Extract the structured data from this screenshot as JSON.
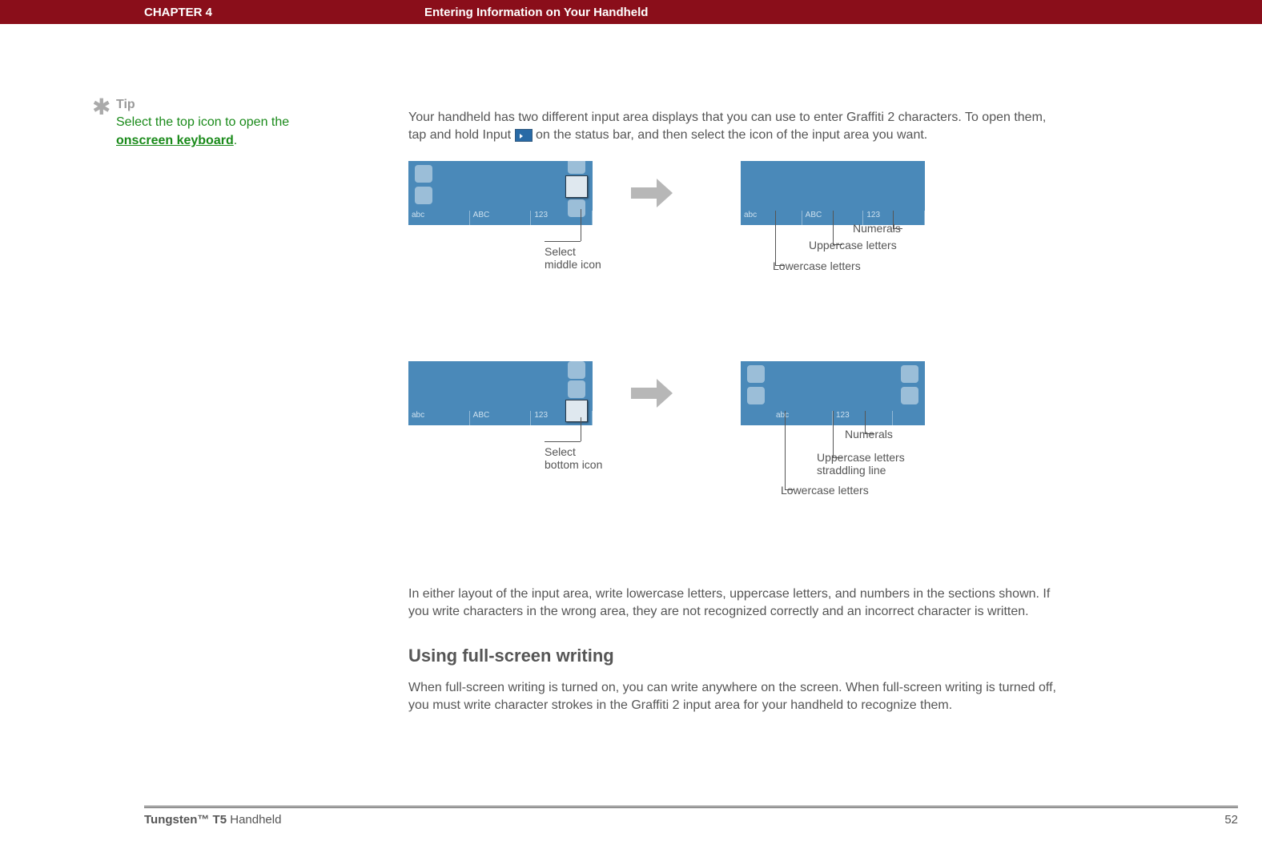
{
  "header": {
    "chapter": "CHAPTER 4",
    "title": "Entering Information on Your Handheld"
  },
  "tip": {
    "label": "Tip",
    "body_pre": "Select the top icon to open the ",
    "link": "onscreen keyboard",
    "body_post": "."
  },
  "intro": {
    "part1": "Your handheld has two different input area displays that you can use to enter Graffiti 2 characters. To open them, tap and hold Input ",
    "part2": " on the status bar, and then select the icon of the input area you want."
  },
  "zones": {
    "abc_lower": "abc",
    "abc_upper": "ABC",
    "num": "123"
  },
  "diag1": {
    "select_caption": "Select\nmiddle icon",
    "lowercase": "Lowercase letters",
    "uppercase": "Uppercase letters",
    "numerals": "Numerals"
  },
  "diag2": {
    "select_caption": "Select\nbottom icon",
    "lowercase": "Lowercase letters",
    "uppercase": "Uppercase letters\nstraddling line",
    "numerals": "Numerals"
  },
  "after_para": "In either layout of the input area, write lowercase letters, uppercase letters, and numbers in the sections shown. If you write characters in the wrong area, they are not recognized correctly and an incorrect character is written.",
  "section2": {
    "heading": "Using full-screen writing",
    "para": "When full-screen writing is turned on, you can write anywhere on the screen. When full-screen writing is turned off, you must write character strokes in the Graffiti 2 input area for your handheld to recognize them."
  },
  "footer": {
    "product_bold": "Tungsten™ T5",
    "product_rest": " Handheld",
    "page": "52"
  }
}
